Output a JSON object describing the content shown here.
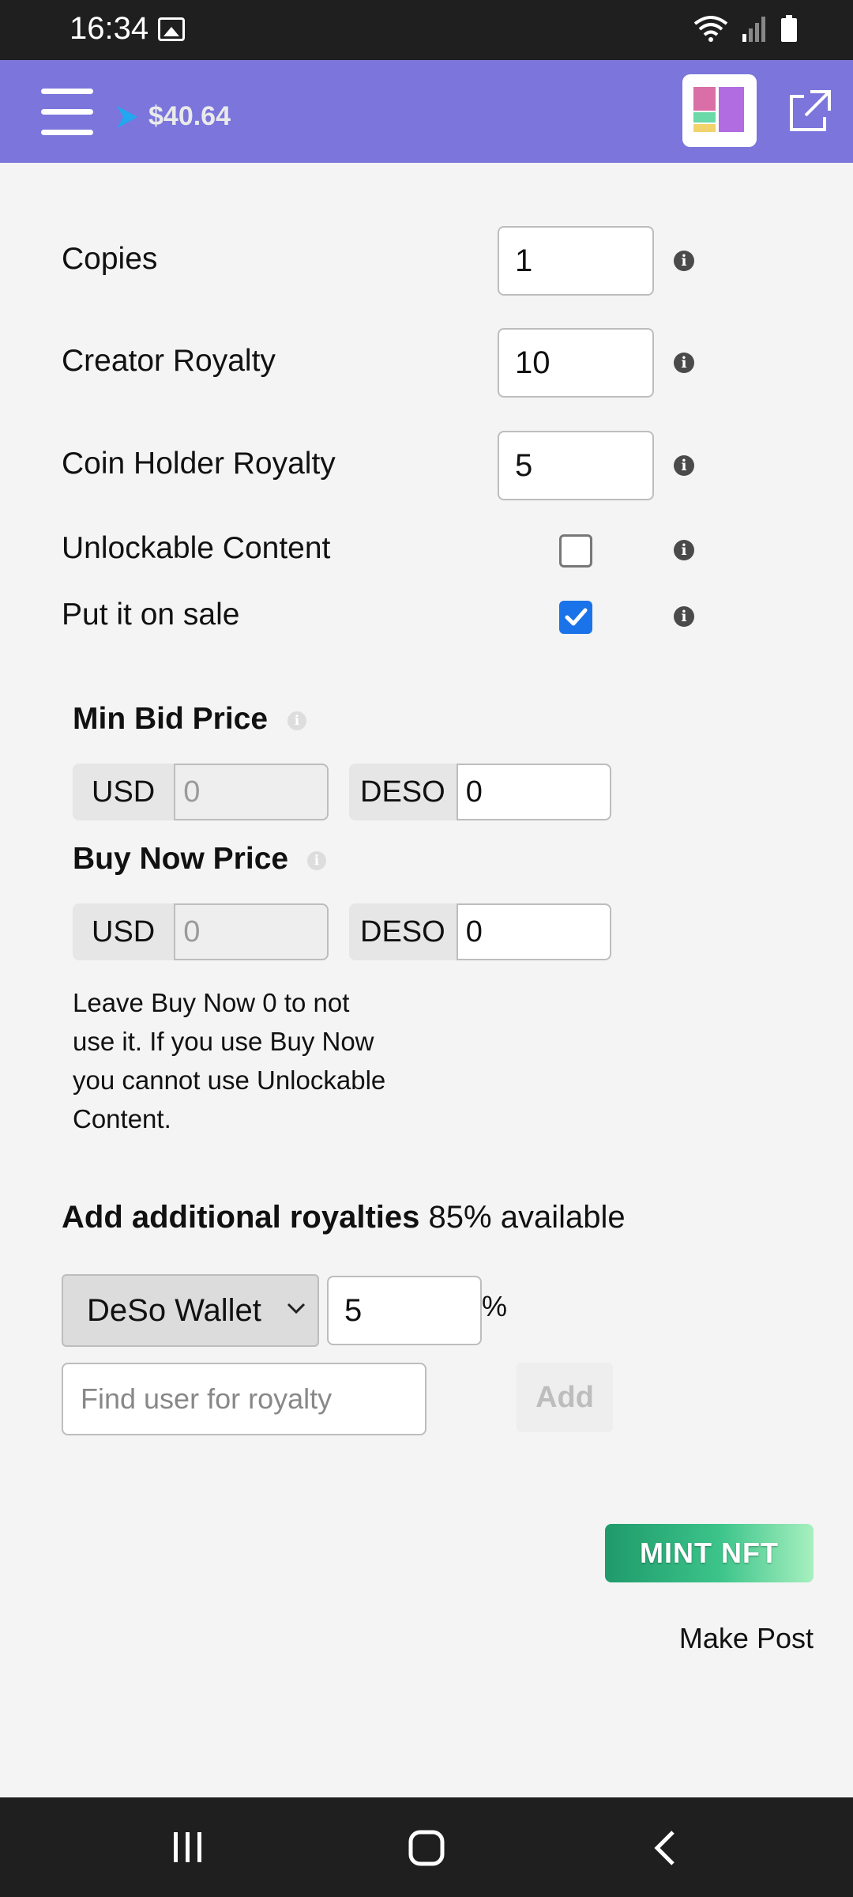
{
  "status_bar": {
    "time": "16:34"
  },
  "header": {
    "balance": "$40.64"
  },
  "form": {
    "copies": {
      "label": "Copies",
      "value": "1"
    },
    "creator_royalty": {
      "label": "Creator Royalty",
      "value": "10"
    },
    "coin_holder_royalty": {
      "label": "Coin Holder Royalty",
      "value": "5"
    },
    "unlockable_content": {
      "label": "Unlockable Content",
      "checked": false
    },
    "put_on_sale": {
      "label": "Put it on sale",
      "checked": true
    }
  },
  "min_bid": {
    "title": "Min Bid Price",
    "usd_label": "USD",
    "usd_value": "0",
    "deso_label": "DESO",
    "deso_value": "0"
  },
  "buy_now": {
    "title": "Buy Now Price",
    "usd_label": "USD",
    "usd_value": "0",
    "deso_label": "DESO",
    "deso_value": "0"
  },
  "help_text": "Leave Buy Now 0 to not use it. If you use Buy Now you cannot use Unlockable Content.",
  "royalties": {
    "heading": "Add additional royalties",
    "available": "85% available",
    "wallet_option": "DeSo Wallet",
    "percent_value": "5",
    "percent_sign": "%",
    "find_user_placeholder": "Find user for royalty",
    "add_label": "Add"
  },
  "actions": {
    "mint_label": "MINT NFT",
    "make_post_label": "Make Post"
  },
  "colors": {
    "header_bg": "#7b75dc",
    "checkbox_checked": "#1a73e8",
    "mint_gradient_start": "#1f9a6b",
    "mint_gradient_end": "#a7f0bf"
  }
}
